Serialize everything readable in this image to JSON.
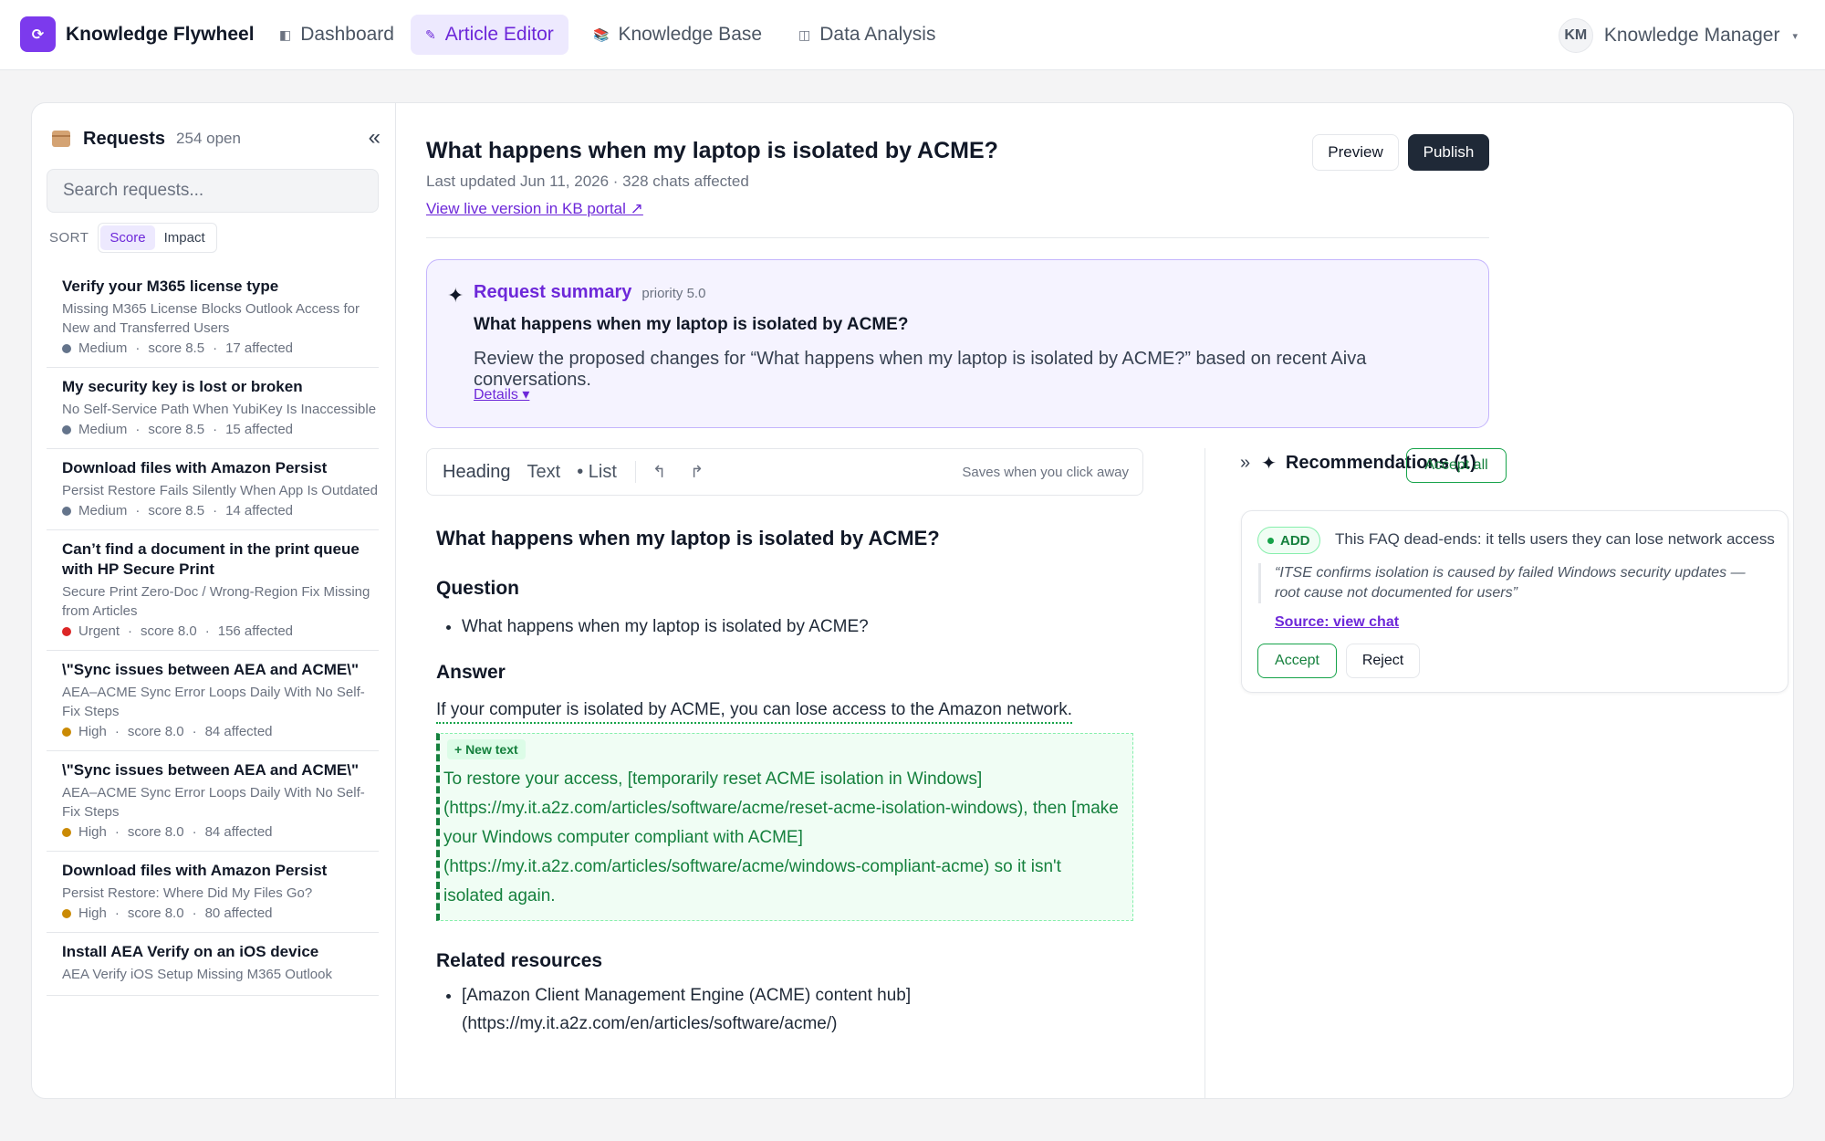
{
  "app": {
    "logo_glyph": "⟳",
    "title": "Knowledge Flywheel"
  },
  "nav": {
    "tabs": [
      {
        "icon": "dashboard-icon",
        "glyph": "◧",
        "label": "Dashboard"
      },
      {
        "icon": "pencil-icon",
        "glyph": "✎",
        "label": "Article Editor",
        "active": true
      },
      {
        "icon": "books-icon",
        "glyph": "📚",
        "label": "Knowledge Base"
      },
      {
        "icon": "chart-icon",
        "glyph": "◫",
        "label": "Data Analysis"
      }
    ]
  },
  "user": {
    "initials": "KM",
    "name": "Knowledge Manager",
    "caret": "▾"
  },
  "sidebar": {
    "title": "Requests",
    "count": "254 open",
    "collapse_glyph": "«",
    "search_placeholder": "Search requests...",
    "sort_label": "SORT",
    "sort_options": [
      "Score",
      "Impact"
    ],
    "items": [
      {
        "title": "Verify your M365 license type",
        "subtitle": "Missing M365 License Blocks Outlook Access for New and Transferred Users",
        "priority": "Medium",
        "score": "score 8.5",
        "affected": "17 affected"
      },
      {
        "title": "My security key is lost or broken",
        "subtitle": "No Self-Service Path When YubiKey Is Inaccessible",
        "priority": "Medium",
        "score": "score 8.5",
        "affected": "15 affected"
      },
      {
        "title": "Download files with Amazon Persist",
        "subtitle": "Persist Restore Fails Silently When App Is Outdated",
        "priority": "Medium",
        "score": "score 8.5",
        "affected": "14 affected"
      },
      {
        "title": "Can’t find a document in the print queue with HP Secure Print",
        "subtitle": "Secure Print Zero-Doc / Wrong-Region Fix Missing from Articles",
        "priority": "Urgent",
        "score": "score 8.0",
        "affected": "156 affected"
      },
      {
        "title": "\\\"Sync issues between AEA and ACME\\\"",
        "subtitle": "AEA–ACME Sync Error Loops Daily With No Self-Fix Steps",
        "priority": "High",
        "score": "score 8.0",
        "affected": "84 affected"
      },
      {
        "title": "\\\"Sync issues between AEA and ACME\\\"",
        "subtitle": "AEA–ACME Sync Error Loops Daily With No Self-Fix Steps",
        "priority": "High",
        "score": "score 8.0",
        "affected": "84 affected"
      },
      {
        "title": "Download files with Amazon Persist",
        "subtitle": "Persist Restore: Where Did My Files Go?",
        "priority": "High",
        "score": "score 8.0",
        "affected": "80 affected"
      },
      {
        "title": "Install AEA Verify on an iOS device",
        "subtitle": "AEA Verify iOS Setup Missing M365 Outlook",
        "priority": "",
        "score": "",
        "affected": ""
      }
    ],
    "priority_colors": {
      "Medium": "#64748b",
      "Urgent": "#dc2626",
      "High": "#ca8a04"
    }
  },
  "article": {
    "title": "What happens when my laptop is isolated by ACME?",
    "meta": "Last updated Jun 11, 2026 · 328 chats affected",
    "live_link": "View live version in KB portal ↗",
    "preview_label": "Preview",
    "publish_label": "Publish"
  },
  "summary": {
    "label": "Request summary",
    "priority": "priority 5.0",
    "question": "What happens when my laptop is isolated by ACME?",
    "description": "Review the proposed changes for “What happens when my laptop is isolated by ACME?” based on recent Aiva conversations.",
    "details": "Details ▾"
  },
  "toolbar": {
    "heading": "Heading",
    "text": "Text",
    "list": "• List",
    "undo_glyph": "↰",
    "redo_glyph": "↱",
    "save_note": "Saves when you click away"
  },
  "doc": {
    "h1": "What happens when my laptop is isolated by ACME?",
    "question_heading": "Question",
    "question_item": "What happens when my laptop is isolated by ACME?",
    "answer_heading": "Answer",
    "answer_text": "If your computer is isolated by ACME, you can lose access to the Amazon network.",
    "new_tag": "+ New text",
    "new_text": "To restore your access, [temporarily reset ACME isolation in Windows](https://my.it.a2z.com/articles/software/acme/reset-acme-isolation-windows), then [make your Windows computer compliant with ACME](https://my.it.a2z.com/articles/software/acme/windows-compliant-acme) so it isn't isolated again.",
    "related_heading": "Related resources",
    "related_item": "[Amazon Client Management Engine (ACME) content hub](https://my.it.a2z.com/en/articles/software/acme/)"
  },
  "recommendations": {
    "expand_glyph": "»",
    "title": "Recommendations (1)",
    "accept_all": "Accept all",
    "cards": [
      {
        "badge": "ADD",
        "summary": "This FAQ dead-ends: it tells users they can lose network access",
        "quote": "“ITSE confirms isolation is caused by failed Windows security updates — root cause not documented for users”",
        "source": "Source: view chat",
        "accept": "Accept",
        "reject": "Reject"
      }
    ]
  }
}
